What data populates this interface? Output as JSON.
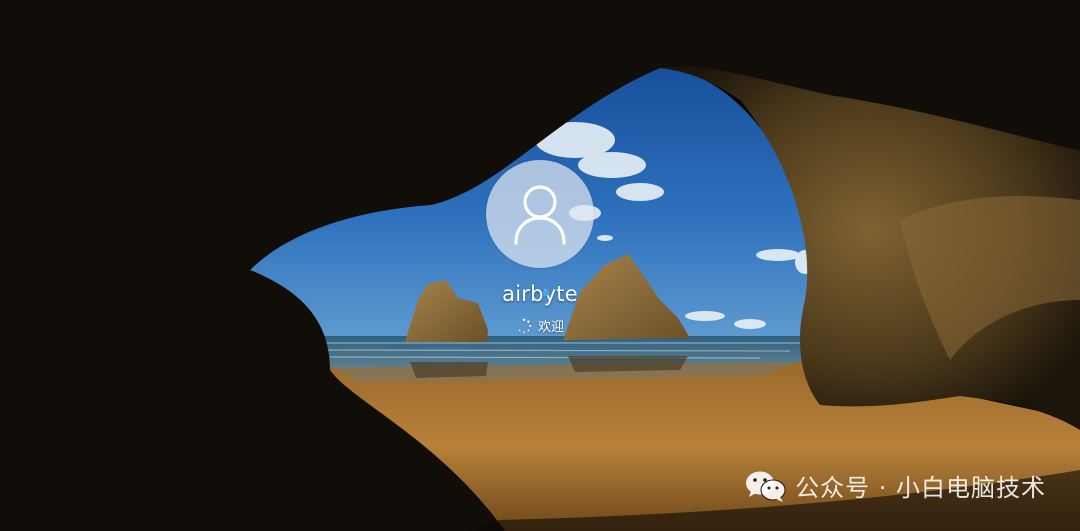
{
  "login": {
    "avatar_icon": "user-icon",
    "username": "airbyte",
    "status_icon": "spinner-icon",
    "status_text": "欢迎"
  },
  "watermark": {
    "icon": "wechat-icon",
    "text": "公众号 · 小白电脑技术"
  },
  "colors": {
    "sky": "#2f6fb8",
    "sand": "#b07a36",
    "cave": "#2b2113",
    "avatar_bg": "#d9e1ea",
    "text": "#ffffff",
    "accent": "#3aa8ff"
  }
}
